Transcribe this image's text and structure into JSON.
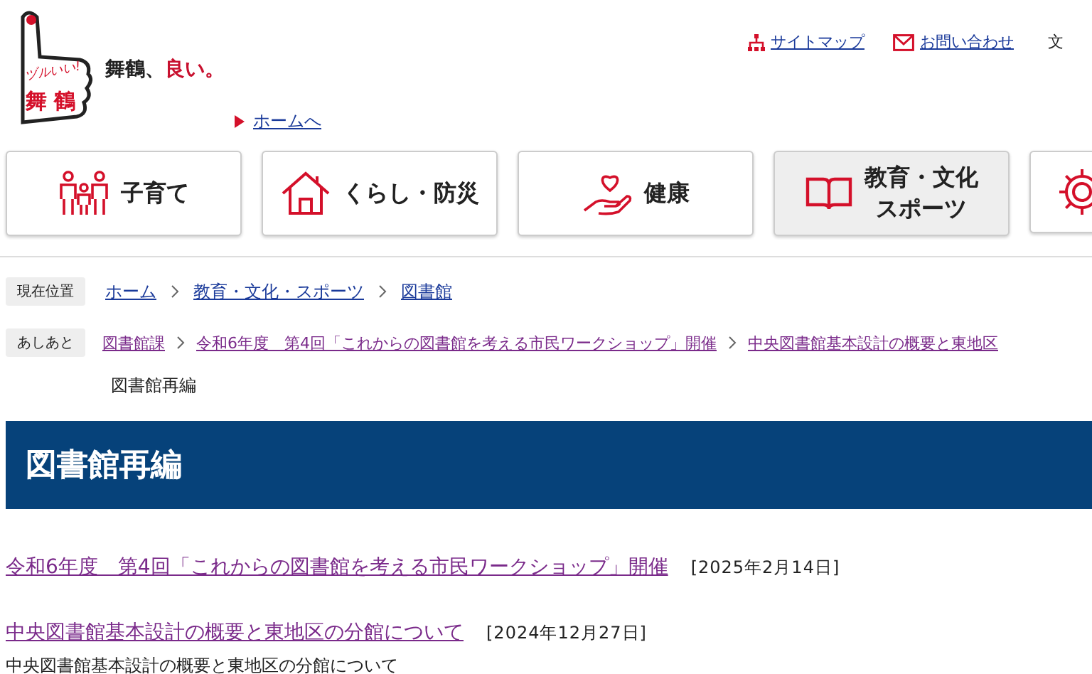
{
  "logo": {
    "catch": "ヅルいい!",
    "name": "舞 鶴"
  },
  "tagline": {
    "text": "舞鶴、",
    "accent": "良い。"
  },
  "header_links": [
    {
      "label": "サイトマップ",
      "kind": "sitemap"
    },
    {
      "label": "お問い合わせ",
      "kind": "mail"
    },
    {
      "label": "文",
      "kind": "plain"
    }
  ],
  "home_link": "ホームへ",
  "nav": [
    {
      "lines": [
        "子育て"
      ],
      "kind": "family",
      "selected": false
    },
    {
      "lines": [
        "くらし・防災"
      ],
      "kind": "house",
      "selected": false
    },
    {
      "lines": [
        "健康"
      ],
      "kind": "heart",
      "selected": false
    },
    {
      "lines": [
        "教育・文化",
        "スポーツ"
      ],
      "kind": "book",
      "selected": true
    },
    {
      "kind": "gear",
      "selected": false
    }
  ],
  "breadcrumb": {
    "label": "現在位置",
    "items": [
      "ホーム",
      "教育・文化・スポーツ",
      "図書館"
    ]
  },
  "history": {
    "label": "あしあと",
    "items": [
      "図書館課",
      "令和6年度　第4回「これからの図書館を考える市民ワークショップ」開催",
      "中央図書館基本設計の概要と東地区"
    ],
    "current": "図書館再編"
  },
  "page_title": "図書館再編",
  "articles": [
    {
      "title": "令和6年度　第4回「これからの図書館を考える市民ワークショップ」開催",
      "date": "[2025年2月14日]"
    },
    {
      "title": "中央図書館基本設計の概要と東地区の分館について",
      "date": "[2024年12月27日]",
      "summary": "中央図書館基本設計の概要と東地区の分館について"
    }
  ]
}
